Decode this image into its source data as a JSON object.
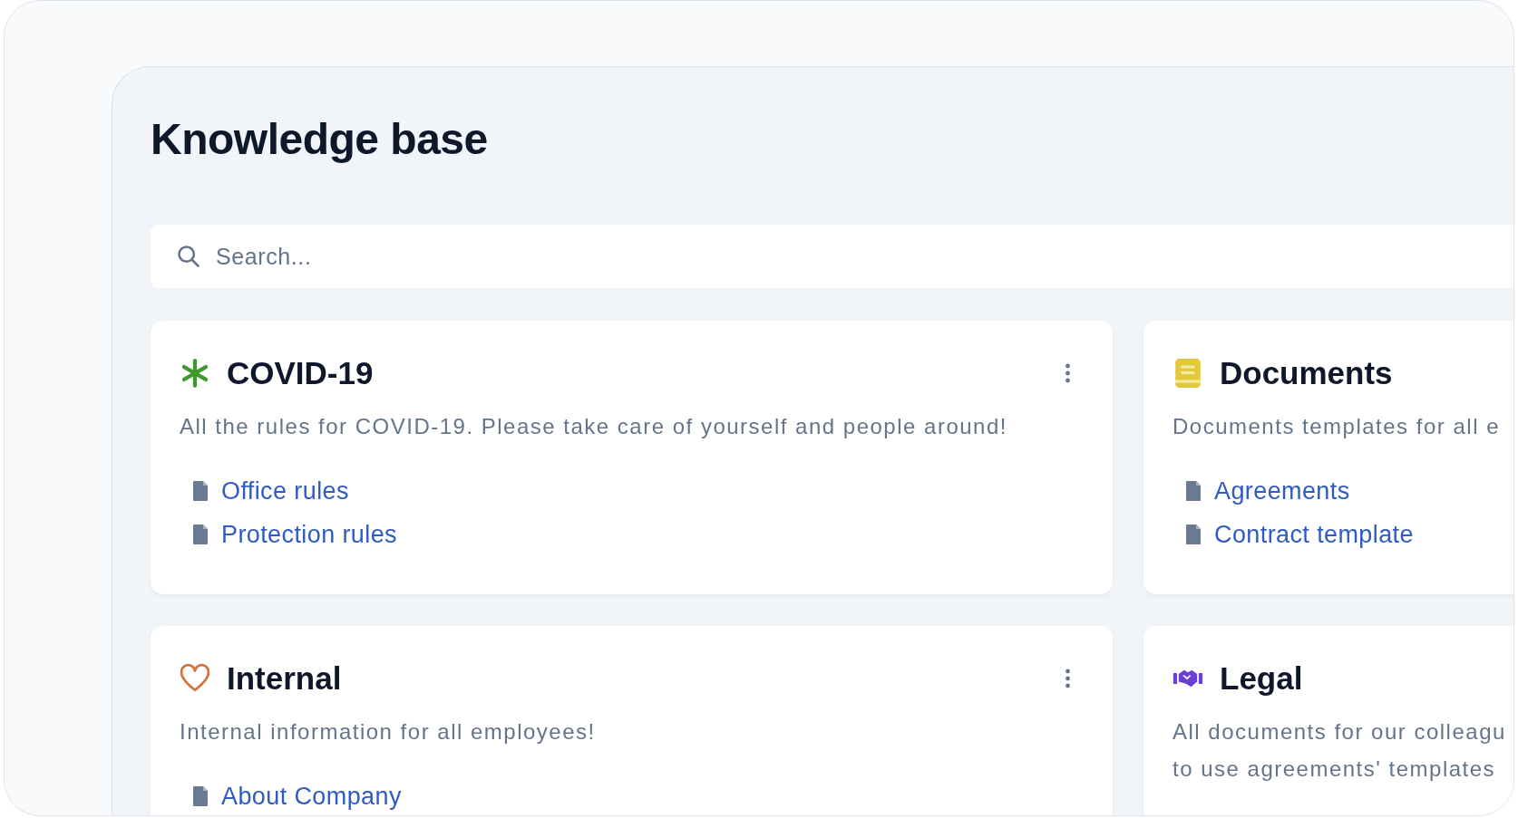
{
  "title": "Knowledge base",
  "search": {
    "placeholder": "Search..."
  },
  "cards": [
    {
      "kind": "asterisk",
      "title": "COVID-19",
      "menu": true,
      "description": [
        "All the rules for COVID-19. Please take care of yourself and people around!"
      ],
      "links": [
        "Office rules",
        "Protection rules"
      ]
    },
    {
      "kind": "book",
      "title": "Documents",
      "description": [
        "Documents templates for all e"
      ],
      "links": [
        "Agreements",
        "Contract template"
      ]
    },
    {
      "kind": "heart",
      "title": "Internal",
      "menu": true,
      "description": [
        "Internal information for all employees!"
      ],
      "links": [
        "About Company"
      ]
    },
    {
      "kind": "handshake",
      "title": "Legal",
      "description": [
        "All documents for our colleagu",
        "to use agreements' templates"
      ]
    }
  ]
}
